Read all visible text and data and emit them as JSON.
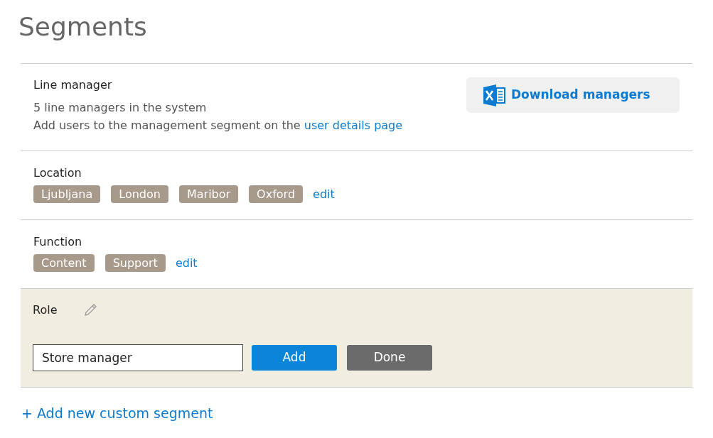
{
  "page_title": "Segments",
  "segments": [
    {
      "kind": "info",
      "title": "Line manager",
      "count_text": "5 line managers in the system",
      "hint_text": "Add users to the management segment on the",
      "hint_link": "user details page",
      "download_button": "Download managers"
    },
    {
      "kind": "tags",
      "title": "Location",
      "tags": [
        "Ljubljana",
        "London",
        "Maribor",
        "Oxford"
      ],
      "edit_link": "edit"
    },
    {
      "kind": "tags",
      "title": "Function",
      "tags": [
        "Content",
        "Support"
      ],
      "edit_link": "edit"
    },
    {
      "kind": "editing",
      "title": "Role",
      "input_value": "Store manager",
      "add_button": "Add",
      "done_button": "Done"
    }
  ],
  "add_segment_link": "+ Add new custom segment"
}
